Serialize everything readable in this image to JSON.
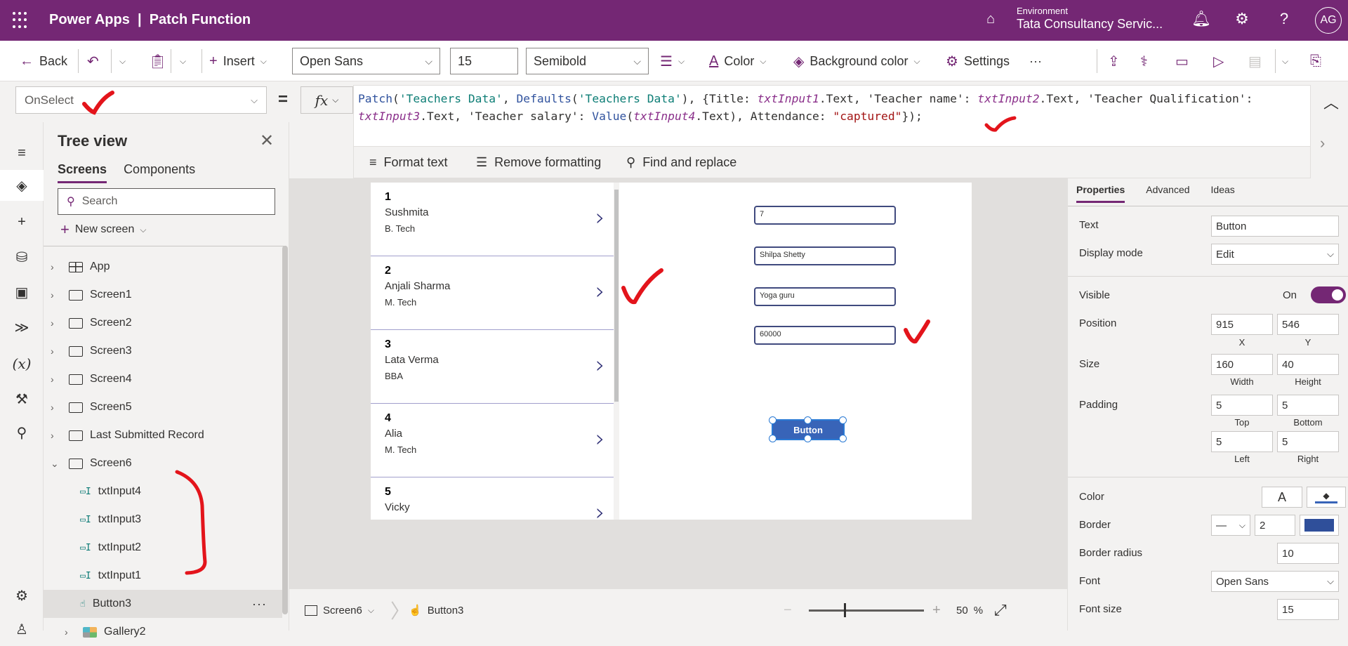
{
  "app": {
    "brand": "Power Apps",
    "separator": "|",
    "app_name": "Patch Function",
    "environment_label": "Environment",
    "environment_name": "Tata Consultancy Servic...",
    "user_initials": "AG"
  },
  "toolbar": {
    "back": "Back",
    "insert": "Insert",
    "font": "Open Sans",
    "font_size": "15",
    "font_weight": "Semibold",
    "color": "Color",
    "background_color": "Background color",
    "settings": "Settings",
    "more": "···"
  },
  "formula": {
    "property": "OnSelect",
    "equals": "=",
    "fx": "fx",
    "tokens": [
      {
        "t": "Patch",
        "c": "k-fn"
      },
      {
        "t": "(",
        "c": ""
      },
      {
        "t": "'Teachers Data'",
        "c": "k-str"
      },
      {
        "t": ", ",
        "c": ""
      },
      {
        "t": "Defaults",
        "c": "k-fn"
      },
      {
        "t": "(",
        "c": ""
      },
      {
        "t": "'Teachers Data'",
        "c": "k-str"
      },
      {
        "t": "), {Title: ",
        "c": ""
      },
      {
        "t": "txtInput1",
        "c": "k-var"
      },
      {
        "t": ".Text, 'Teacher name': ",
        "c": ""
      },
      {
        "t": "txtInput2",
        "c": "k-var"
      },
      {
        "t": ".Text, 'Teacher Qualification':\n",
        "c": ""
      },
      {
        "t": "txtInput3",
        "c": "k-var"
      },
      {
        "t": ".Text, 'Teacher salary': ",
        "c": ""
      },
      {
        "t": "Value",
        "c": "k-fn"
      },
      {
        "t": "(",
        "c": ""
      },
      {
        "t": "txtInput4",
        "c": "k-var"
      },
      {
        "t": ".Text), Attendance: ",
        "c": ""
      },
      {
        "t": "\"captured\"",
        "c": "k-lit"
      },
      {
        "t": "});",
        "c": ""
      }
    ],
    "format_text": "Format text",
    "remove_formatting": "Remove formatting",
    "find_replace": "Find and replace"
  },
  "tree": {
    "title": "Tree view",
    "tabs": [
      "Screens",
      "Components"
    ],
    "search_placeholder": "Search",
    "new_screen": "New screen",
    "items": [
      {
        "label": "App",
        "kind": "app",
        "expand": "›"
      },
      {
        "label": "Screen1",
        "kind": "screen",
        "expand": "›"
      },
      {
        "label": "Screen2",
        "kind": "screen",
        "expand": "›"
      },
      {
        "label": "Screen3",
        "kind": "screen",
        "expand": "›"
      },
      {
        "label": "Screen4",
        "kind": "screen",
        "expand": "›"
      },
      {
        "label": "Screen5",
        "kind": "screen",
        "expand": "›"
      },
      {
        "label": "Last Submitted Record",
        "kind": "screen",
        "expand": "›"
      },
      {
        "label": "Screen6",
        "kind": "screen",
        "expand": "⌄"
      },
      {
        "label": "txtInput4",
        "kind": "textinput"
      },
      {
        "label": "txtInput3",
        "kind": "textinput"
      },
      {
        "label": "txtInput2",
        "kind": "textinput"
      },
      {
        "label": "txtInput1",
        "kind": "textinput"
      },
      {
        "label": "Button3",
        "kind": "button",
        "selected": true
      },
      {
        "label": "Gallery2",
        "kind": "gallery",
        "expand": "›"
      }
    ]
  },
  "canvas": {
    "gallery": [
      {
        "id": "1",
        "name": "Sushmita",
        "qualification": "B. Tech"
      },
      {
        "id": "2",
        "name": "Anjali Sharma",
        "qualification": "M. Tech"
      },
      {
        "id": "3",
        "name": "Lata Verma",
        "qualification": "BBA"
      },
      {
        "id": "4",
        "name": "Alia",
        "qualification": "M. Tech"
      },
      {
        "id": "5",
        "name": "Vicky",
        "qualification": ""
      }
    ],
    "inputs": [
      "7",
      "Shilpa Shetty",
      "Yoga guru",
      "60000"
    ],
    "button_text": "Button"
  },
  "statusbar": {
    "screen": "Screen6",
    "control": "Button3",
    "zoom_value": "50",
    "zoom_unit": "%"
  },
  "properties": {
    "tabs": [
      "Properties",
      "Advanced",
      "Ideas"
    ],
    "text_label": "Text",
    "text_value": "Button",
    "display_mode_label": "Display mode",
    "display_mode_value": "Edit",
    "visible_label": "Visible",
    "visible_value": "On",
    "position_label": "Position",
    "x": "915",
    "y": "546",
    "x_label": "X",
    "y_label": "Y",
    "size_label": "Size",
    "width": "160",
    "height": "40",
    "width_label": "Width",
    "height_label": "Height",
    "padding_label": "Padding",
    "pad_top": "5",
    "pad_bottom": "5",
    "pad_left": "5",
    "pad_right": "5",
    "top_label": "Top",
    "bottom_label": "Bottom",
    "left_label": "Left",
    "right_label": "Right",
    "color_label": "Color",
    "color_glyph": "A",
    "border_label": "Border",
    "border_width": "2",
    "border_radius_label": "Border radius",
    "border_radius": "10",
    "font_label": "Font",
    "font_value": "Open Sans",
    "font_size_label": "Font size",
    "font_size": "15"
  },
  "colors": {
    "brand": "#742774",
    "button_fill": "#3864b8",
    "border_color": "#2f4f9a",
    "annotation": "#e3141b"
  }
}
